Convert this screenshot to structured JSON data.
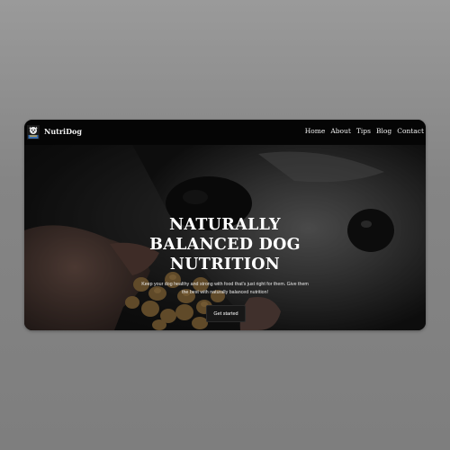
{
  "brand": {
    "name": "NutriDog",
    "logo_icon": "dog-logo-icon"
  },
  "nav": {
    "links": [
      {
        "label": "Home"
      },
      {
        "label": "About"
      },
      {
        "label": "Tips"
      },
      {
        "label": "Blog"
      },
      {
        "label": "Contact"
      }
    ]
  },
  "hero": {
    "headline_line1": "NATURALLY",
    "headline_line2": "BALANCED DOG",
    "headline_line3": "NUTRITION",
    "subtext_line1": "Keep your dog healthy and strong with food that's just right for them. Give them",
    "subtext_line2": "the best with naturally balanced nutrition!",
    "cta_label": "Get started"
  },
  "colors": {
    "page_background": "#8c8c8c",
    "navbar": "#050505",
    "button": "#171717",
    "text": "#ffffff"
  }
}
